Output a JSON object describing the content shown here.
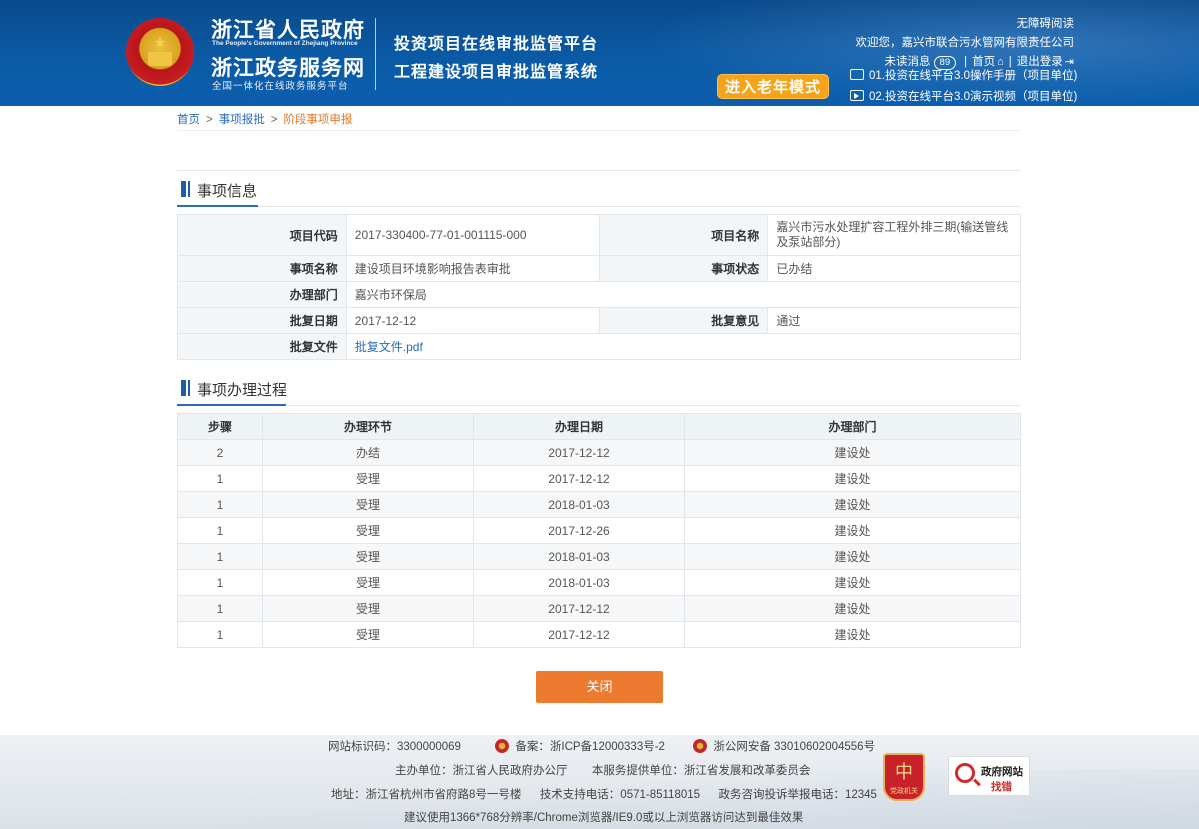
{
  "header": {
    "gov_title_cn": "浙江省人民政府",
    "gov_title_en": "The People's Government of Zhejiang Province",
    "portal_title": "浙江政务服务网",
    "portal_subtitle": "全国一体化在线政务服务平台",
    "system_title_1": "投资项目在线审批监管平台",
    "system_title_2": "工程建设项目审批监管系统",
    "elder_mode_label": "进入老年模式",
    "accessibility_label": "无障碍阅读",
    "welcome_text": "欢迎您，嘉兴市联合污水管网有限责任公司",
    "unread_label": "未读消息",
    "unread_count": "89",
    "home_label": "首页",
    "logout_label": "退出登录",
    "links": [
      {
        "label": "01.投资在线平台3.0操作手册（项目单位)",
        "icon": "document-icon"
      },
      {
        "label": "02.投资在线平台3.0演示视频（项目单位)",
        "icon": "video-play-icon"
      }
    ]
  },
  "breadcrumb": {
    "home": "首页",
    "level2": "事项报批",
    "current": "阶段事项申报"
  },
  "info_section": {
    "title": "事项信息",
    "fields": {
      "project_code_label": "项目代码",
      "project_code": "2017-330400-77-01-001115-000",
      "project_name_label": "项目名称",
      "project_name": "嘉兴市污水处理扩容工程外排三期(输送管线及泵站部分)",
      "item_name_label": "事项名称",
      "item_name": "建设项目环境影响报告表审批",
      "item_status_label": "事项状态",
      "item_status": "已办结",
      "dept_label": "办理部门",
      "dept": "嘉兴市环保局",
      "approval_date_label": "批复日期",
      "approval_date": "2017-12-12",
      "approval_opinion_label": "批复意见",
      "approval_opinion": "通过",
      "approval_doc_label": "批复文件",
      "approval_doc": "批复文件.pdf"
    }
  },
  "process_section": {
    "title": "事项办理过程",
    "columns": [
      "步骤",
      "办理环节",
      "办理日期",
      "办理部门"
    ],
    "rows": [
      [
        "2",
        "办结",
        "2017-12-12",
        "建设处"
      ],
      [
        "1",
        "受理",
        "2017-12-12",
        "建设处"
      ],
      [
        "1",
        "受理",
        "2018-01-03",
        "建设处"
      ],
      [
        "1",
        "受理",
        "2017-12-26",
        "建设处"
      ],
      [
        "1",
        "受理",
        "2018-01-03",
        "建设处"
      ],
      [
        "1",
        "受理",
        "2018-01-03",
        "建设处"
      ],
      [
        "1",
        "受理",
        "2017-12-12",
        "建设处"
      ],
      [
        "1",
        "受理",
        "2017-12-12",
        "建设处"
      ]
    ]
  },
  "close_button": "关闭",
  "footer": {
    "site_id": "网站标识码：3300000069",
    "icp": "备案：浙ICP备12000333号-2",
    "police": "浙公网安备 33010602004556号",
    "host": "主办单位：浙江省人民政府办公厅",
    "provider": "本服务提供单位：浙江省发展和改革委员会",
    "address": "地址：浙江省杭州市省府路8号一号楼",
    "support": "技术支持电话：0571-85118015",
    "hotline": "政务咨询投诉举报电话：12345",
    "browser_tip": "建议使用1366*768分辨率/Chrome浏览器/IE9.0或以上浏览器访问达到最佳效果",
    "badge_text": "党政机关",
    "badge_char": "中",
    "error_site_title": "政府网站",
    "error_site_sub": "找错"
  }
}
